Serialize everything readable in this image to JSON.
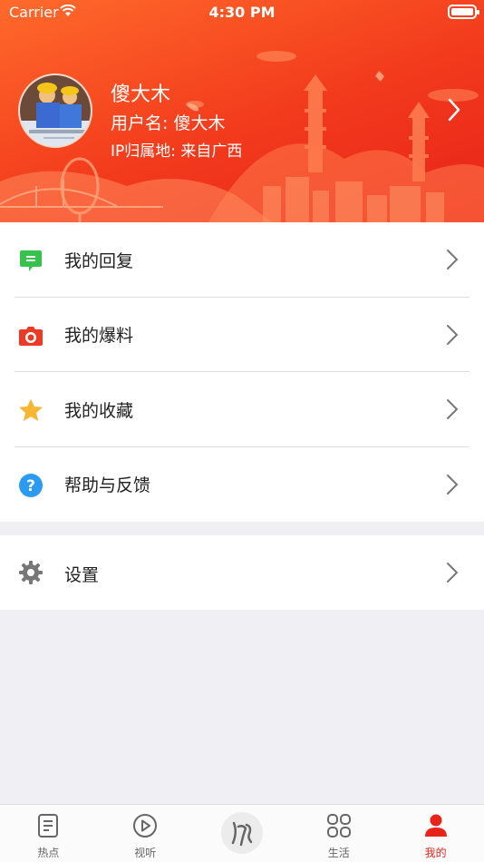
{
  "status_bar": {
    "carrier": "Carrier",
    "time": "4:30 PM"
  },
  "profile": {
    "nickname": "傻大木",
    "username": "用户名: 傻大木",
    "ip_location": "IP归属地: 来自广西"
  },
  "menu": {
    "items": [
      {
        "label": "我的回复",
        "icon": "reply-icon"
      },
      {
        "label": "我的爆料",
        "icon": "camera-icon"
      },
      {
        "label": "我的收藏",
        "icon": "star-icon"
      },
      {
        "label": "帮助与反馈",
        "icon": "help-icon"
      }
    ],
    "settings": {
      "label": "设置",
      "icon": "gear-icon"
    }
  },
  "tabbar": {
    "tabs": [
      {
        "label": "热点",
        "icon": "news-icon"
      },
      {
        "label": "视听",
        "icon": "play-icon"
      },
      {
        "label": "",
        "icon": "logo-icon"
      },
      {
        "label": "生活",
        "icon": "grid-icon"
      },
      {
        "label": "我的",
        "icon": "person-icon",
        "active": true
      }
    ]
  },
  "colors": {
    "accent": "#e8231a",
    "header_start": "#ff6a2b",
    "header_end": "#e8231a"
  }
}
